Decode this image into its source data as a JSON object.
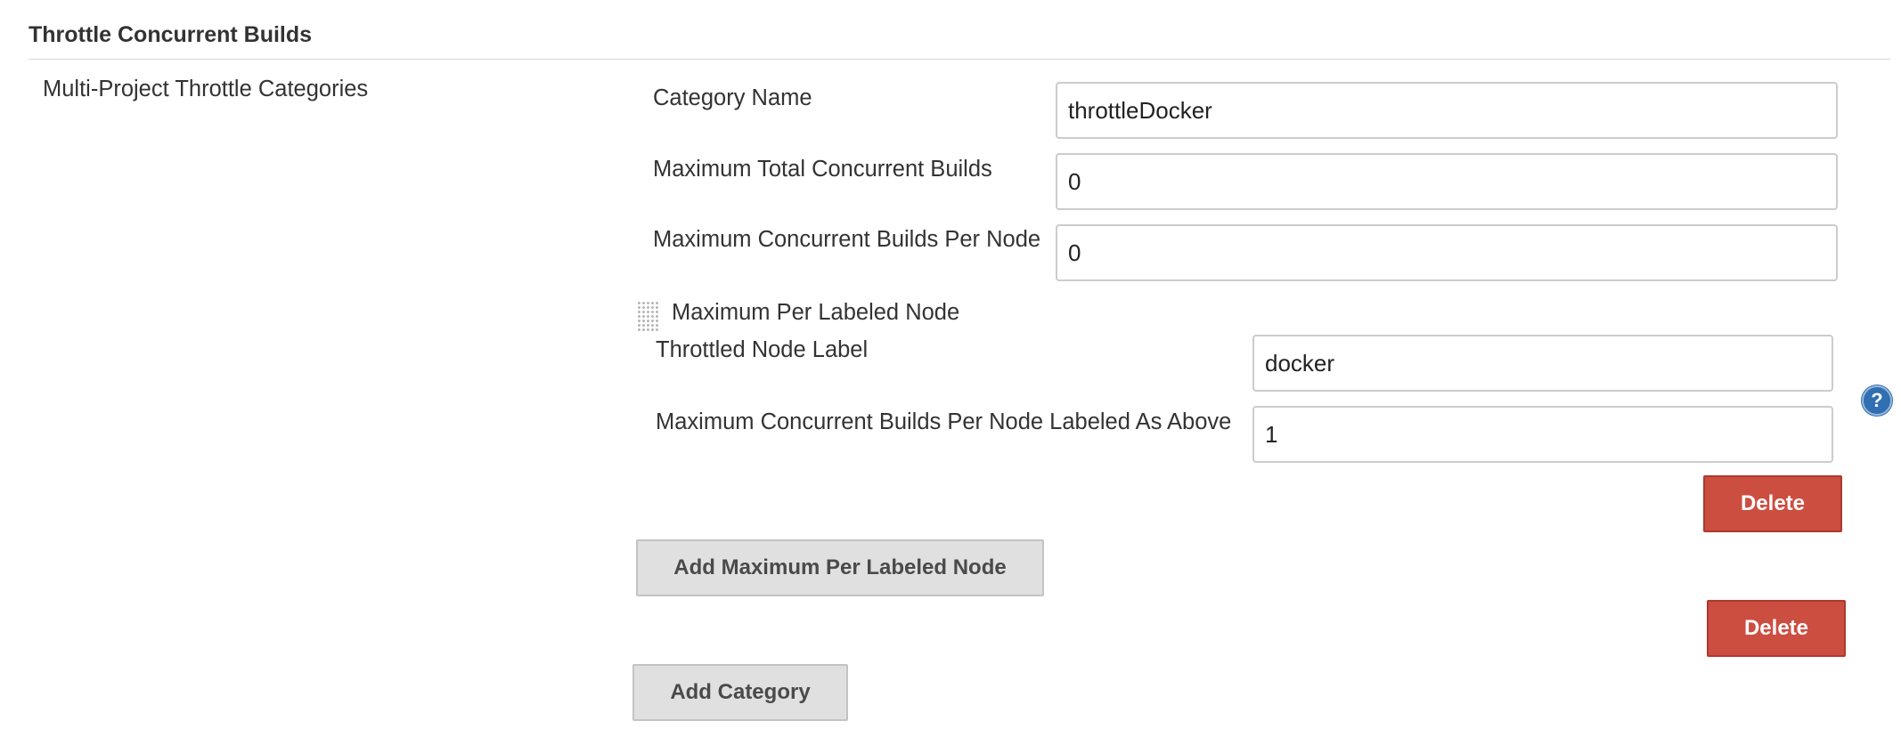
{
  "section": {
    "title": "Throttle Concurrent Builds",
    "categories_label": "Multi-Project Throttle Categories"
  },
  "category": {
    "name_label": "Category Name",
    "name_value": "throttleDocker",
    "max_total_label": "Maximum Total Concurrent Builds",
    "max_total_value": "0",
    "max_per_node_label": "Maximum Concurrent Builds Per Node",
    "max_per_node_value": "0",
    "labeled_node": {
      "header": "Maximum Per Labeled Node",
      "node_label_label": "Throttled Node Label",
      "node_label_value": "docker",
      "max_labeled_label": "Maximum Concurrent Builds Per Node Labeled As Above",
      "max_labeled_value": "1",
      "delete_label": "Delete",
      "help_icon": "question-mark"
    },
    "add_labeled_node_label": "Add Maximum Per Labeled Node",
    "delete_label": "Delete"
  },
  "add_category_label": "Add Category",
  "colors": {
    "delete_button": "#cc4e41",
    "gray_button": "#e0e0e0",
    "help_icon": "#2f6fb2"
  }
}
